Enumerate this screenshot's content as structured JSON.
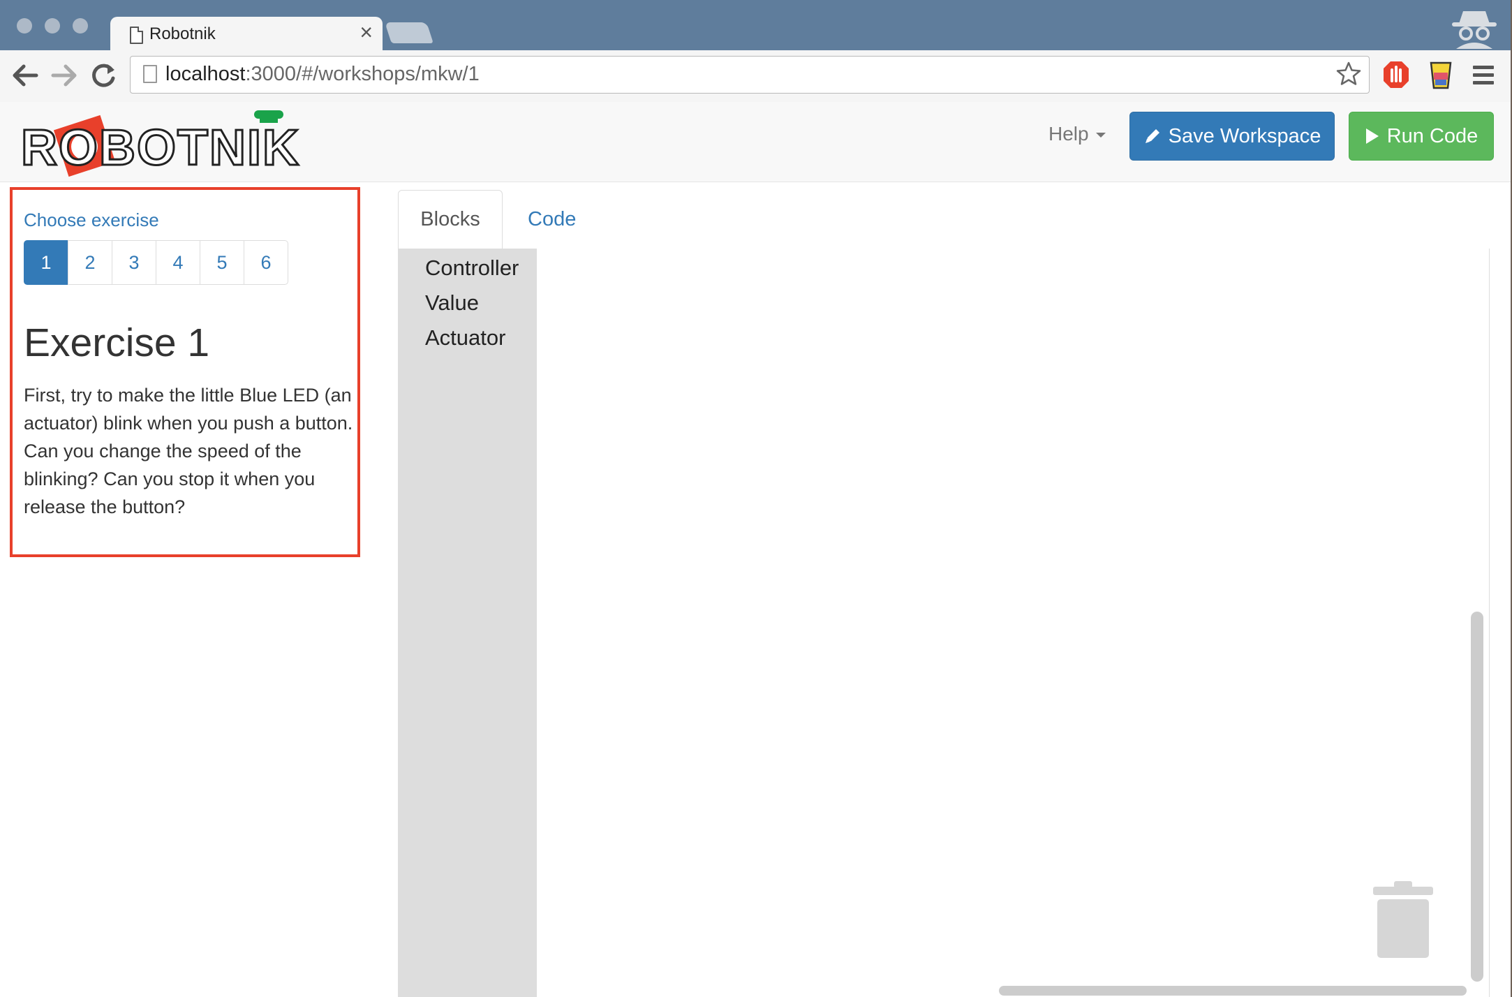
{
  "browser": {
    "tab_title": "Robotnik",
    "tab_close": "×",
    "url_host": "localhost",
    "url_path": ":3000/#/workshops/mkw/1"
  },
  "navbar": {
    "logo_text": "ROBOTNIK",
    "help_label": "Help",
    "save_label": "Save Workspace",
    "run_label": "Run Code"
  },
  "exercise_panel": {
    "choose_label": "Choose exercise",
    "pages": [
      "1",
      "2",
      "3",
      "4",
      "5",
      "6"
    ],
    "active_page": "1",
    "title": "Exercise 1",
    "description": "First, try to make the little Blue LED (an actuator) blink when you push a button. Can you change the speed of the blinking? Can you stop it when you release the button?"
  },
  "editor": {
    "tabs": [
      "Blocks",
      "Code"
    ],
    "active_tab": "Blocks",
    "categories": [
      "Controller",
      "Value",
      "Actuator"
    ]
  },
  "colors": {
    "primary": "#337ab7",
    "success": "#5cb85c",
    "highlight_border": "#e8402b",
    "logo_red": "#e8402b",
    "logo_green": "#1aa34a"
  }
}
